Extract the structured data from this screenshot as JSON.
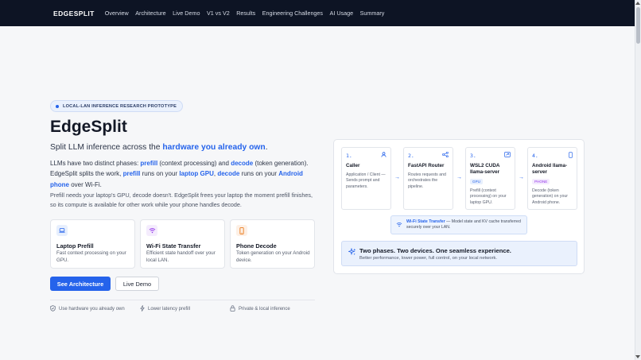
{
  "nav": {
    "brand": "EDGESPLIT",
    "links": [
      "Overview",
      "Architecture",
      "Live Demo",
      "V1 vs V2",
      "Results",
      "Engineering Challenges",
      "AI Usage",
      "Summary"
    ]
  },
  "hero": {
    "badge": "LOCAL-LAN INFERENCE RESEARCH PROTOTYPE",
    "title": "EdgeSplit",
    "subtitle_pre": "Split LLM inference across the ",
    "subtitle_hl": "hardware you already own",
    "subtitle_post": ".",
    "desc": {
      "p1": "LLMs have two distinct phases: ",
      "prefill1": "prefill",
      "p2": " (context processing) and ",
      "decode1": "decode",
      "p3": " (token generation). EdgeSplit splits the work, ",
      "prefill2": "prefill",
      "p4": " runs on your ",
      "gpu": "laptop GPU",
      "p5": ", ",
      "decode2": "decode",
      "p6": " runs on your ",
      "phone": "Android phone",
      "p7": " over Wi-Fi."
    },
    "desc2": "Prefill needs your laptop's GPU, decode doesn't. EdgeSplit frees your laptop the moment prefill finishes, so its compute is available for other work while your phone handles decode.",
    "features": [
      {
        "title": "Laptop Prefill",
        "desc": "Fast context processing on your GPU.",
        "icon": "laptop-icon"
      },
      {
        "title": "Wi-Fi State Transfer",
        "desc": "Efficient state handoff over your local LAN.",
        "icon": "wifi-icon"
      },
      {
        "title": "Phone Decode",
        "desc": "Token generation on your Android device.",
        "icon": "phone-icon"
      }
    ],
    "primary_button": "See Architecture",
    "secondary_button": "Live Demo",
    "perks": [
      "Use hardware you already own",
      "Lower latency prefill",
      "Private & local inference"
    ]
  },
  "pipeline": {
    "steps": [
      {
        "num": "1.",
        "title": "Caller",
        "tag": "",
        "desc": "Application / Client — Sends prompt and parameters.",
        "icon": "user-icon"
      },
      {
        "num": "2.",
        "title": "FastAPI Router",
        "tag": "",
        "desc": "Routes requests and orchestrates the pipeline.",
        "icon": "share-icon"
      },
      {
        "num": "3.",
        "title": "WSL2 CUDA llama-server",
        "tag": "GPU",
        "desc": "Prefill (context processing) on your laptop GPU.",
        "icon": "monitor-icon"
      },
      {
        "num": "4.",
        "title": "Android llama-server",
        "tag": "PHONE",
        "desc": "Decode (token generation) on your Android phone.",
        "icon": "phone-icon"
      }
    ],
    "transfer_label": "Wi-Fi State Transfer",
    "transfer_desc": " — Model state and KV cache transferred securely over your LAN.",
    "summary_title": "Two phases. Two devices. One seamless experience.",
    "summary_desc": "Better performance, lower power, full control, on your local network."
  },
  "colors": {
    "accent": "#2563eb",
    "nav_bg": "#0d1424"
  }
}
